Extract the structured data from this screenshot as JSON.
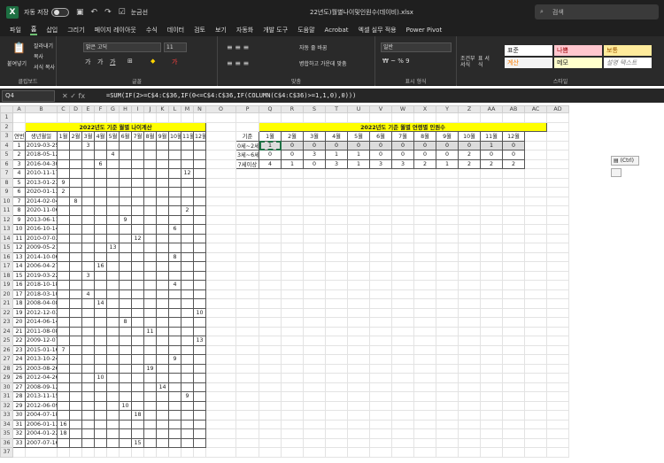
{
  "titlebar": {
    "autosave_label": "자동 저장",
    "autosave_state": "끔",
    "filename": "22년도)월별나이및인원수(데이비).xlsx",
    "search_placeholder": "검색",
    "qa_label": "눈금선"
  },
  "tabs": [
    "파일",
    "홈",
    "삽입",
    "그리기",
    "페이지 레이아웃",
    "수식",
    "데이터",
    "검토",
    "보기",
    "자동화",
    "개발 도구",
    "도움말",
    "Acrobat",
    "엑셀 실무 적용",
    "Power Pivot"
  ],
  "ribbon": {
    "clipboard": {
      "label": "클립보드",
      "paste": "붙여넣기",
      "cut": "잘라내기",
      "copy": "복사",
      "format": "서식 복사"
    },
    "font": {
      "label": "글꼴",
      "name": "맑은 고딕",
      "size": "11"
    },
    "align": {
      "label": "맞춤",
      "wrap": "자동 줄 바꿈",
      "merge": "병합하고 가운데 맞춤"
    },
    "number": {
      "label": "표시 형식",
      "format": "일반"
    },
    "cond": {
      "cond_label": "조건부 서식",
      "table_label": "표 서식"
    },
    "styles": {
      "label": "스타일",
      "items": [
        "표준",
        "나쁨",
        "보통",
        "계산",
        "메모",
        "설명 텍스트"
      ]
    }
  },
  "formula_bar": {
    "cell": "Q4",
    "fx": "fx",
    "formula": "=SUM(IF(2>=C$4:C$36,IF(0<=C$4:C$36,IF(COLUMN(C$4:C$36)>=1,1,0),0)))"
  },
  "columns": [
    "A",
    "B",
    "C",
    "D",
    "E",
    "F",
    "G",
    "H",
    "I",
    "J",
    "K",
    "L",
    "M",
    "N",
    "O",
    "P",
    "Q",
    "R",
    "S",
    "T",
    "U",
    "V",
    "W",
    "X",
    "Y",
    "Z",
    "AA",
    "AB",
    "AC",
    "AD"
  ],
  "left_table": {
    "title": "2022년도 기준 월별 나이계산",
    "hdr_no": "연번",
    "hdr_birth": "생년월일",
    "months": [
      "1월",
      "2월",
      "3월",
      "4월",
      "5월",
      "6월",
      "7월",
      "8월",
      "9월",
      "10월",
      "11월",
      "12월"
    ],
    "rows": [
      [
        1,
        "2019-03-25",
        3,
        3
      ],
      [
        2,
        "2018-05-12",
        5,
        4
      ],
      [
        3,
        "2016-04-30",
        4,
        6
      ],
      [
        4,
        "2010-11-17",
        11,
        12
      ],
      [
        5,
        "2013-01-23",
        1,
        9
      ],
      [
        6,
        "2020-01-13",
        1,
        2
      ],
      [
        7,
        "2014-02-04",
        2,
        8
      ],
      [
        8,
        "2020-11-06",
        11,
        2
      ],
      [
        9,
        "2013-06-11",
        6,
        9
      ],
      [
        10,
        "2016-10-14",
        10,
        6
      ],
      [
        11,
        "2010-07-03",
        7,
        12
      ],
      [
        12,
        "2009-05-21",
        5,
        13
      ],
      [
        13,
        "2014-10-06",
        10,
        8
      ],
      [
        14,
        "2006-04-27",
        4,
        16
      ],
      [
        15,
        "2019-03-22",
        3,
        3
      ],
      [
        16,
        "2018-10-18",
        10,
        4
      ],
      [
        17,
        "2018-03-10",
        3,
        4
      ],
      [
        18,
        "2008-04-08",
        4,
        14
      ],
      [
        19,
        "2012-12-03",
        12,
        10
      ],
      [
        20,
        "2014-06-14",
        6,
        8
      ],
      [
        21,
        "2011-08-08",
        8,
        11
      ],
      [
        22,
        "2009-12-07",
        12,
        13
      ],
      [
        23,
        "2015-01-16",
        1,
        7
      ],
      [
        24,
        "2013-10-24",
        10,
        9
      ],
      [
        25,
        "2003-08-26",
        8,
        19
      ],
      [
        26,
        "2012-04-26",
        4,
        10
      ],
      [
        27,
        "2008-09-12",
        9,
        14
      ],
      [
        28,
        "2013-11-15",
        11,
        9
      ],
      [
        29,
        "2012-06-09",
        6,
        10
      ],
      [
        30,
        "2004-07-18",
        7,
        18
      ],
      [
        31,
        "2006-01-13",
        1,
        16
      ],
      [
        32,
        "2004-01-22",
        1,
        18
      ],
      [
        33,
        "2007-07-16",
        7,
        15
      ]
    ]
  },
  "right_table": {
    "title": "2022년도 기준 월별 연령별 인원수",
    "hdr": "기준",
    "rows": [
      {
        "label": "0세~2세",
        "values": [
          1,
          0,
          0,
          0,
          0,
          0,
          0,
          0,
          0,
          0,
          1,
          0
        ]
      },
      {
        "label": "3세~6세",
        "values": [
          0,
          0,
          3,
          1,
          1,
          0,
          0,
          0,
          0,
          2,
          0,
          0
        ]
      },
      {
        "label": "7세이상",
        "values": [
          4,
          1,
          0,
          3,
          1,
          3,
          3,
          2,
          1,
          2,
          2,
          2
        ]
      }
    ]
  },
  "paste_label": "(Ctrl)"
}
